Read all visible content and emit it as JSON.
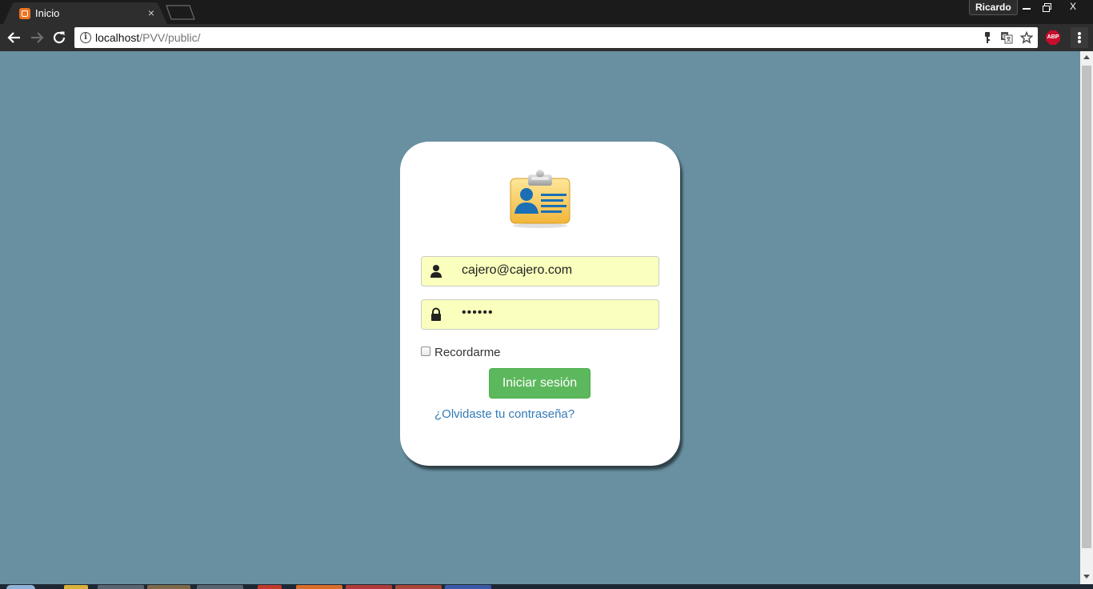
{
  "browser": {
    "tab": {
      "title": "Inicio",
      "close_label": "×"
    },
    "profile_name": "Ricardo",
    "window_controls": {
      "close_label": "X"
    },
    "address": {
      "host": "localhost",
      "path": "/PVV/public/"
    },
    "extension_label": "ABP"
  },
  "login": {
    "email_value": "cajero@cajero.com",
    "password_value": "••••••",
    "remember_label": "Recordarme",
    "remember_checked": false,
    "submit_label": "Iniciar sesión",
    "forgot_label": "¿Olvidaste tu contraseña?"
  },
  "colors": {
    "page_background": "#6890a1",
    "autofill_background": "#faffbd",
    "button_green": "#5cb85c",
    "link_blue": "#337ab7"
  }
}
